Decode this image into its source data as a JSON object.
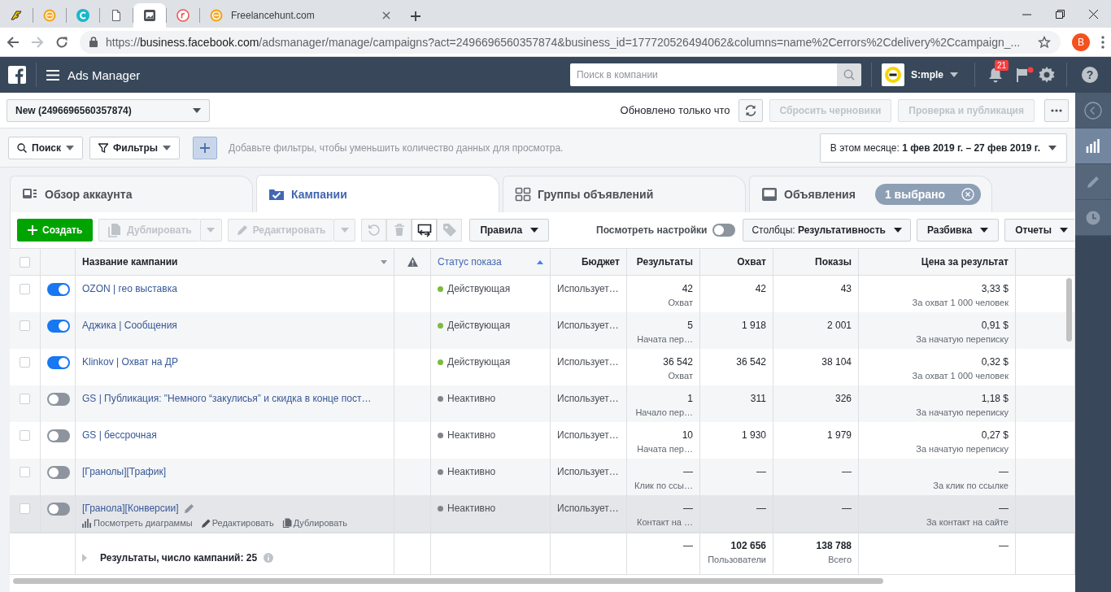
{
  "browser": {
    "tabs": [
      {
        "selected": false
      },
      {
        "selected": false
      },
      {
        "selected": false
      },
      {
        "selected": false
      },
      {
        "selected": true
      },
      {
        "selected": false
      },
      {
        "title": "Freelancehunt.com",
        "selected": false
      }
    ],
    "url": {
      "scheme": "https://",
      "host": "business.facebook.com",
      "path": "/adsmanager/manage/campaigns?act=2496696560357874&business_id=177720526494062&columns=name%2Cerrors%2Cdelivery%2Ccampaign_..."
    },
    "profile_initial": "B"
  },
  "topbar": {
    "title": "Ads Manager",
    "search": {
      "placeholder": "Поиск в компании"
    },
    "account": "S:mple",
    "notifications": "21",
    "help": "?"
  },
  "side_nav": [
    {
      "selected": true
    },
    {
      "selected": false
    },
    {
      "selected": false
    }
  ],
  "account_bar": {
    "account": "New (2496696560357874)",
    "updated": "Обновлено только что",
    "buttons": [
      {
        "label": "Сбросить черновики",
        "disabled": true
      },
      {
        "label": "Проверка и публикация",
        "disabled": true
      }
    ]
  },
  "filter_bar": {
    "search": "Поиск",
    "filters": "Фильтры",
    "hint": "Добавьте фильтры, чтобы уменьшить количество данных для просмотра.",
    "date_range": "В этом месяце: **1 фев 2019 г. – 27 фев 2019 г.**"
  },
  "level_tabs": [
    {
      "label": "Обзор аккаунта",
      "selected": false
    },
    {
      "label": "Кампании",
      "selected": true
    },
    {
      "label": "Группы объявлений",
      "selected": false
    },
    {
      "label": "Объявления",
      "selected": false,
      "badge": "1 выбрано"
    }
  ],
  "toolbar": {
    "create": "Создать",
    "duplicate": {
      "label": "Дублировать",
      "disabled": true
    },
    "edit": {
      "label": "Редактировать",
      "disabled": true
    },
    "icon_buttons": [
      {
        "disabled": true
      },
      {
        "disabled": true
      },
      {
        "disabled": false
      },
      {
        "disabled": true
      }
    ],
    "rules": "Правила",
    "view_settings": {
      "label": "Посмотреть настройки",
      "on": false
    },
    "columns": "Столбцы: **Результативность**",
    "breakdown": "Разбивка",
    "reports": "Отчеты"
  },
  "table": {
    "all_selected": false,
    "columns": [
      {
        "label": "Название кампании",
        "sorted": false
      },
      {
        "label": "Статус показа",
        "sorted": true
      },
      {
        "label": "Бюджет",
        "sorted": false
      },
      {
        "label": "Результаты",
        "sorted": false
      },
      {
        "label": "Охват",
        "sorted": false
      },
      {
        "label": "Показы",
        "sorted": false
      },
      {
        "label": "Цена за результат",
        "sorted": false
      }
    ],
    "rows": [
      {
        "selected": false,
        "on": true,
        "hovered": false,
        "name": "OZON | гео выставка",
        "status": "Действующая",
        "color": "#7cbb3b",
        "budget": "Использует…",
        "results": "42",
        "results_type": "Охват",
        "reach": "42",
        "impressions": "43",
        "cost": "3,33 $",
        "cost_type": "За охват 1 000 человек"
      },
      {
        "selected": false,
        "on": true,
        "hovered": false,
        "name": "Аджика | Сообщения",
        "status": "Действующая",
        "color": "#7cbb3b",
        "budget": "Использует…",
        "results": "5",
        "results_type": "Начата пер…",
        "reach": "1 918",
        "impressions": "2 001",
        "cost": "0,91 $",
        "cost_type": "За начатую переписку"
      },
      {
        "selected": false,
        "on": true,
        "hovered": false,
        "name": "Klinkov | Охват на ДР",
        "status": "Действующая",
        "color": "#7cbb3b",
        "budget": "Использует…",
        "results": "36 542",
        "results_type": "Охват",
        "reach": "36 542",
        "impressions": "38 104",
        "cost": "0,32 $",
        "cost_type": "За охват 1 000 человек"
      },
      {
        "selected": false,
        "on": false,
        "hovered": false,
        "name": "GS | Публикация: \"Немного “закулисья” и скидка в конце пост…",
        "status": "Неактивно",
        "color": "#80848a",
        "budget": "Использует…",
        "results": "1",
        "results_type": "Начало пер…",
        "reach": "311",
        "impressions": "326",
        "cost": "1,18 $",
        "cost_type": "За начатую переписку"
      },
      {
        "selected": false,
        "on": false,
        "hovered": false,
        "name": "GS | бессрочная",
        "status": "Неактивно",
        "color": "#80848a",
        "budget": "Использует…",
        "results": "10",
        "results_type": "Начата пер…",
        "reach": "1 930",
        "impressions": "1 979",
        "cost": "0,27 $",
        "cost_type": "За начатую переписку"
      },
      {
        "selected": false,
        "on": false,
        "hovered": false,
        "name": "[Гранолы][Трафик]",
        "status": "Неактивно",
        "color": "#80848a",
        "budget": "Использует…",
        "results": "—",
        "results_type": "Клик по ссы…",
        "reach": "—",
        "impressions": "—",
        "cost": "—",
        "cost_type": "За клик по ссылке"
      },
      {
        "selected": false,
        "on": false,
        "hovered": true,
        "name": "[Гранола][Конверсии]",
        "actions": [
          "Посмотреть диаграммы",
          "Редактировать",
          "Дублировать"
        ],
        "status": "Неактивно",
        "color": "#80848a",
        "budget": "Использует…",
        "results": "—",
        "results_type": "Контакт на …",
        "reach": "—",
        "impressions": "—",
        "cost": "—",
        "cost_type": "За контакт на сайте"
      }
    ],
    "totals": {
      "label": "Результаты, число кампаний: 25",
      "results": "—",
      "reach": "102 656",
      "reach_type": "Пользователи",
      "impressions": "138 788",
      "impressions_type": "Всего",
      "cost": "—"
    }
  }
}
